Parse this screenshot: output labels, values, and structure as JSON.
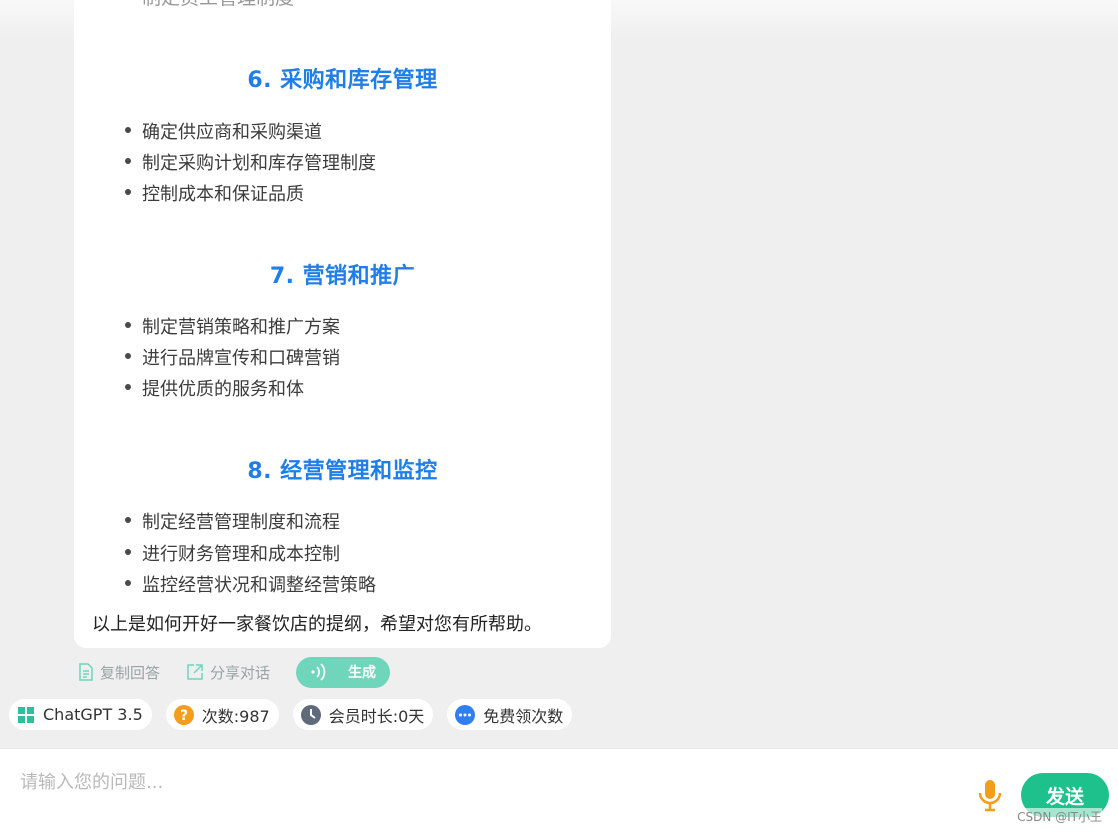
{
  "answer": {
    "cut_off_line": "制定员工管理制度",
    "sections": [
      {
        "heading": "6. 采购和库存管理",
        "items": [
          "确定供应商和采购渠道",
          "制定采购计划和库存管理制度",
          "控制成本和保证品质"
        ]
      },
      {
        "heading": "7. 营销和推广",
        "items": [
          "制定营销策略和推广方案",
          "进行品牌宣传和口碑营销",
          "提供优质的服务和体"
        ]
      },
      {
        "heading": "8. 经营管理和监控",
        "items": [
          "制定经营管理制度和流程",
          "进行财务管理和成本控制",
          "监控经营状况和调整经营策略"
        ]
      }
    ],
    "closing": "以上是如何开好一家餐饮店的提纲，希望对您有所帮助。"
  },
  "actions": {
    "copy_label": "复制回答",
    "share_label": "分享对话",
    "generate_label": "生成"
  },
  "chips": {
    "model": "ChatGPT 3.5",
    "count": "次数:987",
    "membership": "会员时长:0天",
    "free": "免费领次数"
  },
  "input": {
    "placeholder": "请输入您的问题...",
    "send_label": "发送"
  },
  "watermark": "CSDN @IT小王",
  "colors": {
    "heading": "#1f7ee8",
    "accent_green": "#1ec08b",
    "generate_bg": "#6fd6bc",
    "mic": "#f29d1c"
  }
}
